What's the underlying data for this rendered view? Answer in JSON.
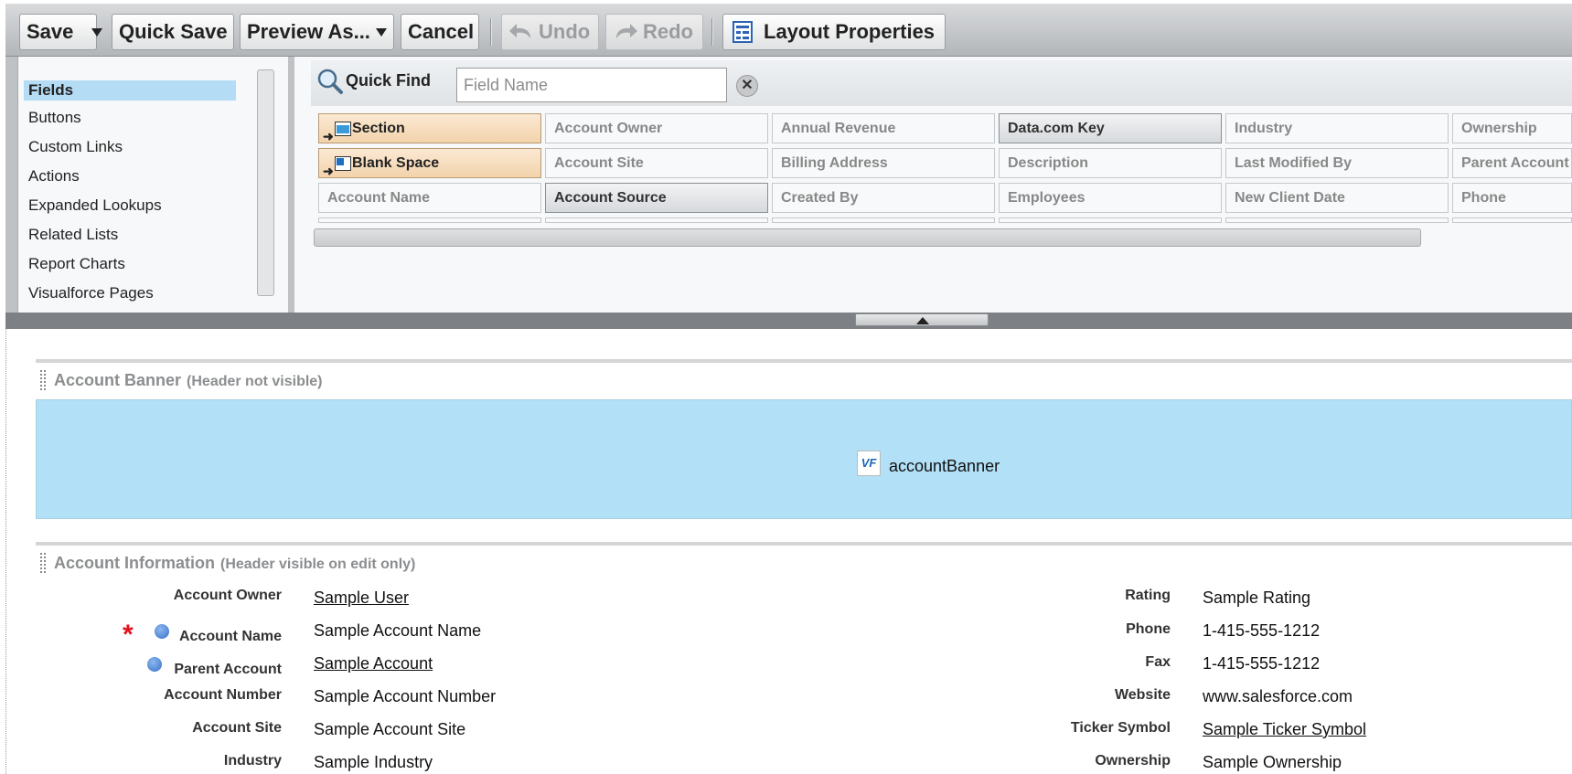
{
  "toolbar": {
    "save": "Save",
    "quick_save": "Quick Save",
    "preview_as": "Preview As...",
    "cancel": "Cancel",
    "undo": "Undo",
    "redo": "Redo",
    "layout_properties": "Layout Properties"
  },
  "categories": [
    "Fields",
    "Buttons",
    "Custom Links",
    "Actions",
    "Expanded Lookups",
    "Related Lists",
    "Report Charts",
    "Visualforce Pages"
  ],
  "quick_find": {
    "label": "Quick Find",
    "placeholder": "Field Name"
  },
  "fields": {
    "col1": [
      "Section",
      "Blank Space",
      "Account Name"
    ],
    "col2": [
      "Account Owner",
      "Account Site",
      "Account Source"
    ],
    "col3": [
      "Annual Revenue",
      "Billing Address",
      "Created By"
    ],
    "col4": [
      "Data.com Key",
      "Description",
      "Employees"
    ],
    "col5": [
      "Industry",
      "Last Modified By",
      "New Client Date"
    ],
    "col6": [
      "Ownership",
      "Parent Account",
      "Phone"
    ]
  },
  "banner_section": {
    "title": "Account Banner",
    "note": "(Header not visible)",
    "component": "accountBanner",
    "component_icon": "VF"
  },
  "info_section": {
    "title": "Account Information",
    "note": "(Header visible on edit only)",
    "left": [
      {
        "label": "Account Owner",
        "value": "Sample User"
      },
      {
        "label": "Account Name",
        "value": "Sample Account Name"
      },
      {
        "label": "Parent Account",
        "value": "Sample Account"
      },
      {
        "label": "Account Number",
        "value": "Sample Account Number"
      },
      {
        "label": "Account Site",
        "value": "Sample Account Site"
      },
      {
        "label": "Industry",
        "value": "Sample Industry"
      }
    ],
    "right": [
      {
        "label": "Rating",
        "value": "Sample Rating"
      },
      {
        "label": "Phone",
        "value": "1-415-555-1212"
      },
      {
        "label": "Fax",
        "value": "1-415-555-1212"
      },
      {
        "label": "Website",
        "value": "www.salesforce.com"
      },
      {
        "label": "Ticker Symbol",
        "value": "Sample Ticker Symbol"
      },
      {
        "label": "Ownership",
        "value": "Sample Ownership"
      }
    ],
    "required_marker": "*"
  },
  "colors": {
    "accent": "#b1e0f7",
    "category_active": "#b4dcf5",
    "required": "#e3111e"
  }
}
